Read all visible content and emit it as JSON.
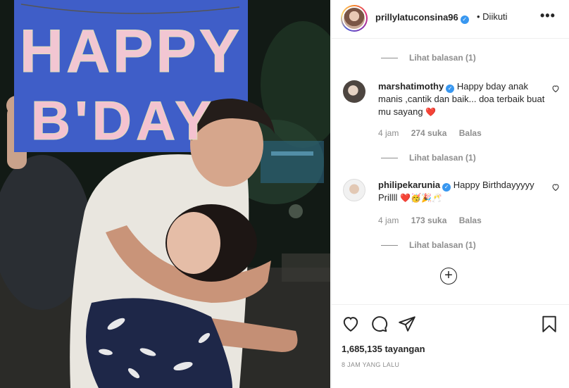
{
  "post": {
    "sign_line1": "HAPPY",
    "sign_line2": "B'DAY",
    "sign_color": "#3f5ec8"
  },
  "header": {
    "username": "prillylatuconsina96",
    "verified_glyph": "✓",
    "follow_status": "• Diikuti",
    "more_icon": "•••"
  },
  "comments": {
    "reply_top": "Lihat balasan (1)",
    "items": [
      {
        "username": "marshatimothy",
        "text": "Happy bday anak manis ,cantik dan baik... doa terbaik buat mu sayang",
        "emoji": "❤️",
        "time": "4 jam",
        "likes": "274 suka",
        "reply_label": "Balas",
        "view_replies": "Lihat balasan (1)"
      },
      {
        "username": "philipekarunia",
        "text": "Happy Birthdayyyyy Prillll",
        "emoji": "❤️🥳🎉🥂",
        "time": "4 jam",
        "likes": "173 suka",
        "reply_label": "Balas",
        "view_replies": "Lihat balasan (1)"
      }
    ],
    "load_more_icon": "+"
  },
  "actions": {
    "views": "1,685,135 tayangan",
    "posted": "8 JAM YANG LALU"
  },
  "colors": {
    "verified": "#3897f0",
    "heart": "#ed4956",
    "muted_text": "#8e8e8e"
  }
}
